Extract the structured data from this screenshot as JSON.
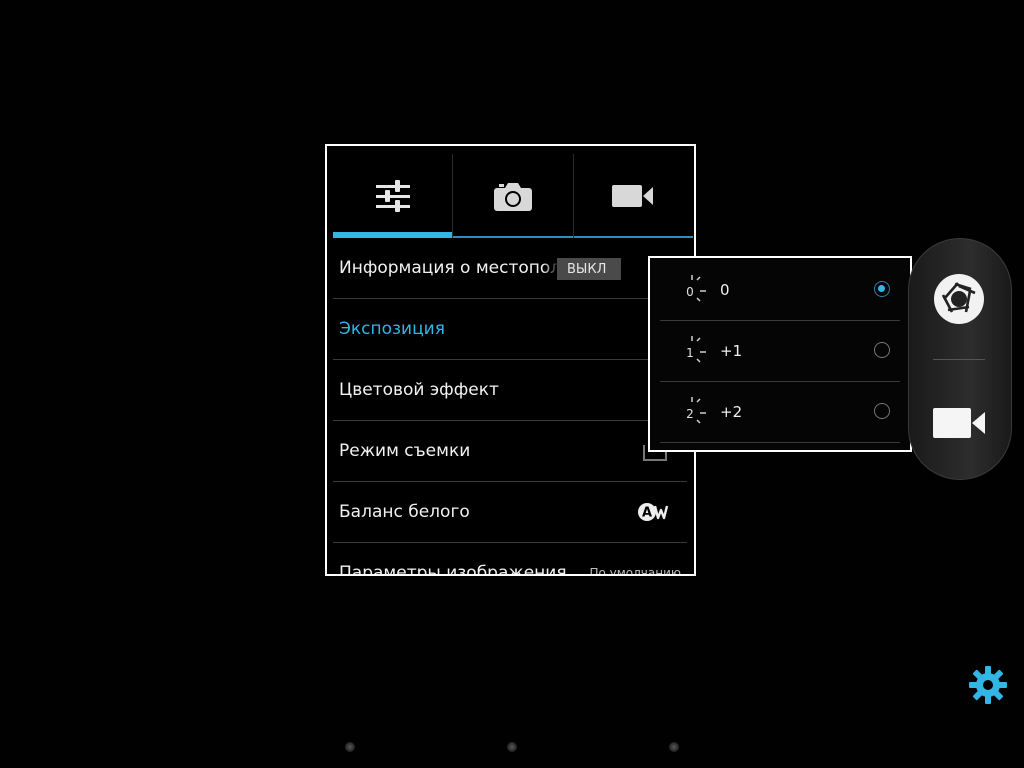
{
  "settings_panel": {
    "tabs": [
      {
        "icon": "sliders-icon",
        "active": true
      },
      {
        "icon": "camera-icon",
        "active": false
      },
      {
        "icon": "video-camera-icon",
        "active": false
      }
    ],
    "rows": {
      "location": {
        "label": "Информация о местопол",
        "toggle": "ВЫКЛ"
      },
      "exposure": {
        "label": "Экспозиция"
      },
      "color_effect": {
        "label": "Цветовой эффект"
      },
      "scene_mode": {
        "label": "Режим съемки"
      },
      "white_balance": {
        "label": "Баланс белого",
        "icon": "auto-white-balance-icon"
      },
      "image_params": {
        "label": "Параметры изображения",
        "value": "По умолчанию"
      }
    }
  },
  "exposure_popup": {
    "options": [
      {
        "icon_digit": "0",
        "label": "0",
        "selected": true
      },
      {
        "icon_digit": "1",
        "label": "+1",
        "selected": false
      },
      {
        "icon_digit": "2",
        "label": "+2",
        "selected": false
      }
    ]
  },
  "mode_switcher": {
    "shutter_icon": "shutter-icon",
    "video_icon": "video-camera-icon"
  },
  "colors": {
    "accent": "#33b5e5",
    "panel_border": "#ffffff",
    "background": "#000000"
  }
}
